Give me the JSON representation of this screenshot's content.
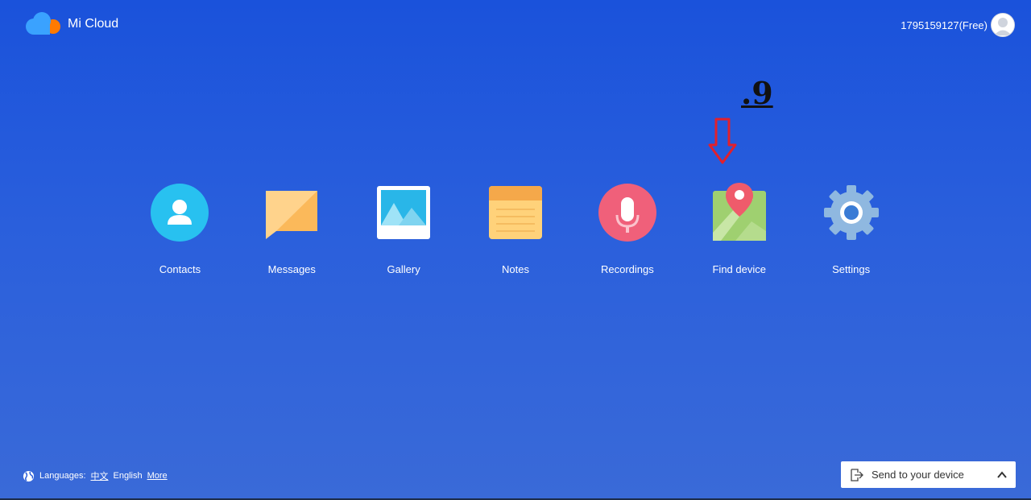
{
  "header": {
    "brand": "Mi Cloud",
    "account_label": "1795159127(Free)"
  },
  "annotation": {
    "text": ".9"
  },
  "apps": [
    {
      "label": "Contacts",
      "icon": "contacts-icon"
    },
    {
      "label": "Messages",
      "icon": "messages-icon"
    },
    {
      "label": "Gallery",
      "icon": "gallery-icon"
    },
    {
      "label": "Notes",
      "icon": "notes-icon"
    },
    {
      "label": "Recordings",
      "icon": "recordings-icon"
    },
    {
      "label": "Find device",
      "icon": "find-device-icon"
    },
    {
      "label": "Settings",
      "icon": "settings-icon"
    }
  ],
  "footer": {
    "languages_label": "Languages:",
    "lang_chinese": "中文",
    "lang_english": "English",
    "more": "More"
  },
  "send_to_device": {
    "label": "Send to your device"
  },
  "colors": {
    "background_top": "#1a52db",
    "annotation_arrow": "#e2202c",
    "contacts": "#28c1f0",
    "recordings": "#f0607a",
    "settings": "#8fb8e0"
  }
}
